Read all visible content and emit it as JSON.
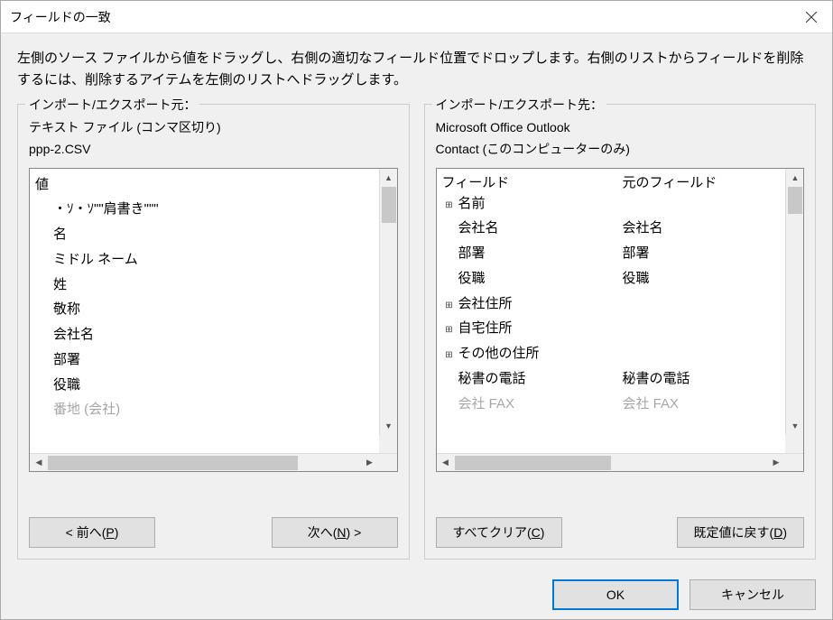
{
  "window": {
    "title": "フィールドの一致"
  },
  "instruction": "左側のソース ファイルから値をドラッグし、右側の適切なフィールド位置でドロップします。右側のリストからフィールドを削除するには、削除するアイテムを左側のリストへドラッグします。",
  "source": {
    "title": "インポート/エクスポート元：",
    "line1": "テキスト ファイル (コンマ区切り)",
    "line2": "ppp-2.CSV",
    "header": "値",
    "items": [
      "・ｿ・ｿ\"\"肩書き\"\"\"",
      "名",
      "ミドル ネーム",
      "姓",
      "敬称",
      "会社名",
      "部署",
      "役職",
      "番地 (会社)"
    ]
  },
  "dest": {
    "title": "インポート/エクスポート先：",
    "line1": "Microsoft Office Outlook",
    "line2": "Contact (このコンピューターのみ)",
    "col1": "フィールド",
    "col2": "元のフィールド",
    "rows": [
      {
        "label": "名前",
        "mapped": "",
        "expandable": true
      },
      {
        "label": "会社名",
        "mapped": "会社名",
        "indent": true
      },
      {
        "label": "部署",
        "mapped": "部署",
        "indent": true
      },
      {
        "label": "役職",
        "mapped": "役職",
        "indent": true
      },
      {
        "label": "会社住所",
        "mapped": "",
        "expandable": true
      },
      {
        "label": "自宅住所",
        "mapped": "",
        "expandable": true
      },
      {
        "label": "その他の住所",
        "mapped": "",
        "expandable": true
      },
      {
        "label": "秘書の電話",
        "mapped": "秘書の電話",
        "indent": true
      },
      {
        "label": "会社 FAX",
        "mapped": "会社 FAX",
        "indent": true
      }
    ]
  },
  "buttons": {
    "prev_pre": "< 前へ(",
    "prev_u": "P",
    "prev_post": ")",
    "next_pre": "次へ(",
    "next_u": "N",
    "next_post": ") >",
    "clear_pre": "すべてクリア(",
    "clear_u": "C",
    "clear_post": ")",
    "default_pre": "既定値に戻す(",
    "default_u": "D",
    "default_post": ")",
    "ok": "OK",
    "cancel": "キャンセル"
  }
}
